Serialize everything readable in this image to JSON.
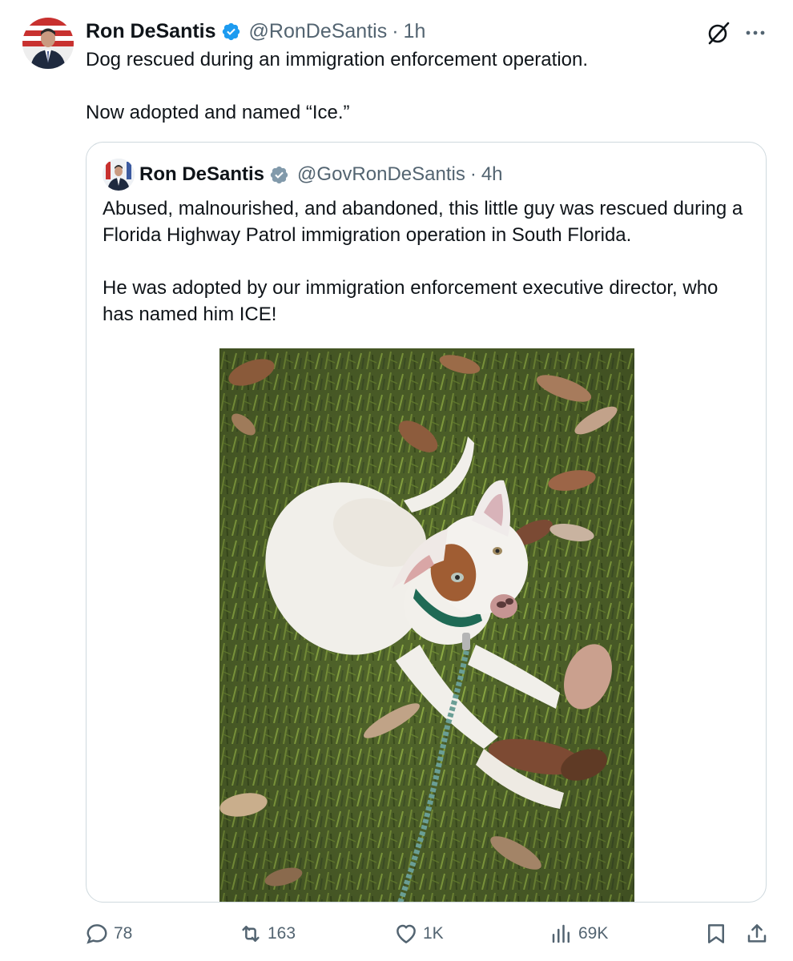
{
  "post": {
    "author_name": "Ron DeSantis",
    "handle": "@RonDeSantis",
    "separator": "·",
    "time": "1h",
    "text": "Dog rescued during an immigration enforcement operation.\n\nNow adopted and named “Ice.”"
  },
  "quoted_post": {
    "author_name": "Ron DeSantis",
    "handle": "@GovRonDeSantis",
    "separator": "·",
    "time": "4h",
    "text": "Abused, malnourished, and abandoned, this little guy was rescued during a Florida Highway Patrol immigration operation in South Florida.\n\nHe was adopted by our immigration enforcement executive director, who has named him ICE!",
    "photo": "white puppy with brown eye patch and green collar lying on grass with dry leaves"
  },
  "actions": {
    "replies": "78",
    "reposts": "163",
    "likes": "1K",
    "views": "69K"
  },
  "icons": {
    "verified": "verified-badge-icon",
    "quoted_verified": "gray-verified-badge-icon",
    "grok": "grok-icon",
    "more": "more-icon",
    "reply": "reply-icon",
    "repost": "repost-icon",
    "like": "heart-icon",
    "views": "views-icon",
    "bookmark": "bookmark-icon",
    "share": "share-icon"
  },
  "colors": {
    "text": "#0f1419",
    "secondary": "#536471",
    "verified_blue": "#1d9bf0",
    "verified_gray": "#829aab",
    "border": "#cfd9de"
  }
}
